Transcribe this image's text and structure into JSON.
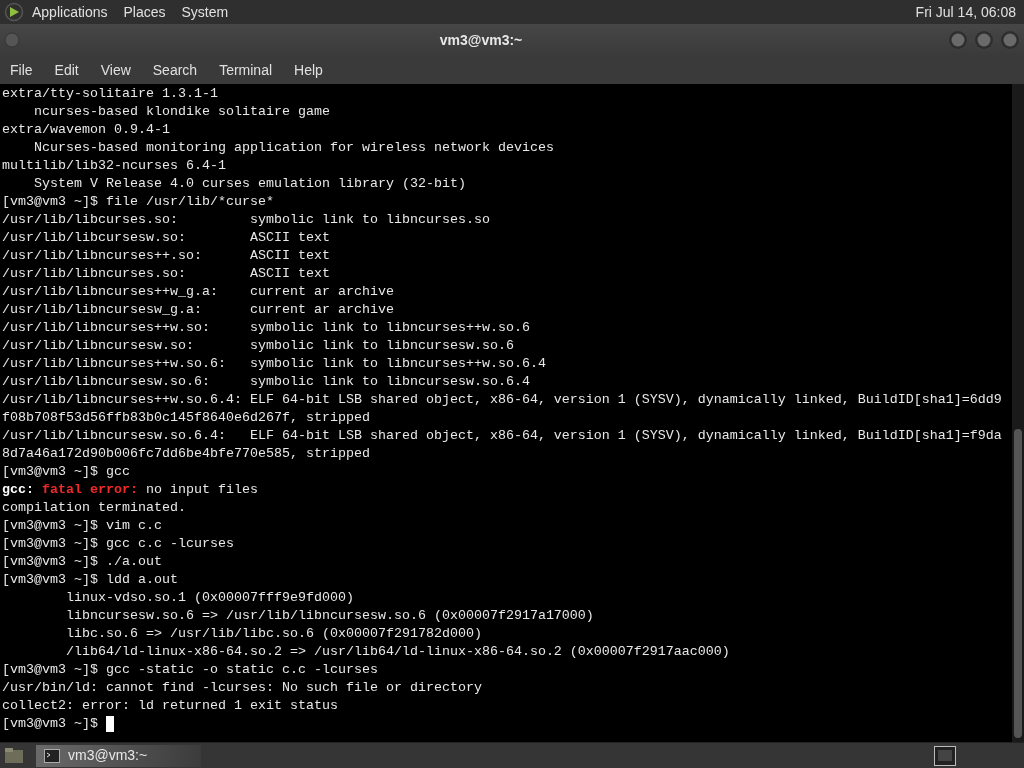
{
  "top_panel": {
    "menus": [
      "Applications",
      "Places",
      "System"
    ],
    "clock": "Fri Jul 14, 06:08"
  },
  "window": {
    "title": "vm3@vm3:~",
    "menu": [
      "File",
      "Edit",
      "View",
      "Search",
      "Terminal",
      "Help"
    ]
  },
  "terminal": {
    "lines": [
      {
        "text": "extra/tty-solitaire 1.3.1-1"
      },
      {
        "text": "    ncurses-based klondike solitaire game"
      },
      {
        "text": "extra/wavemon 0.9.4-1"
      },
      {
        "text": "    Ncurses-based monitoring application for wireless network devices"
      },
      {
        "text": "multilib/lib32-ncurses 6.4-1"
      },
      {
        "text": "    System V Release 4.0 curses emulation library (32-bit)"
      },
      {
        "text": "[vm3@vm3 ~]$ file /usr/lib/*curse*"
      },
      {
        "text": "/usr/lib/libcurses.so:         symbolic link to libncurses.so"
      },
      {
        "text": "/usr/lib/libcursesw.so:        ASCII text"
      },
      {
        "text": "/usr/lib/libncurses++.so:      ASCII text"
      },
      {
        "text": "/usr/lib/libncurses.so:        ASCII text"
      },
      {
        "text": "/usr/lib/libncurses++w_g.a:    current ar archive"
      },
      {
        "text": "/usr/lib/libncursesw_g.a:      current ar archive"
      },
      {
        "text": "/usr/lib/libncurses++w.so:     symbolic link to libncurses++w.so.6"
      },
      {
        "text": "/usr/lib/libncursesw.so:       symbolic link to libncursesw.so.6"
      },
      {
        "text": "/usr/lib/libncurses++w.so.6:   symbolic link to libncurses++w.so.6.4"
      },
      {
        "text": "/usr/lib/libncursesw.so.6:     symbolic link to libncursesw.so.6.4"
      },
      {
        "text": "/usr/lib/libncurses++w.so.6.4: ELF 64-bit LSB shared object, x86-64, version 1 (SYSV), dynamically linked, BuildID[sha1]=6dd9"
      },
      {
        "text": "f08b708f53d56ffb83b0c145f8640e6d267f, stripped"
      },
      {
        "text": "/usr/lib/libncursesw.so.6.4:   ELF 64-bit LSB shared object, x86-64, version 1 (SYSV), dynamically linked, BuildID[sha1]=f9da"
      },
      {
        "text": "8d7a46a172d90b006fc7dd6be4bfe770e585, stripped"
      },
      {
        "text": "[vm3@vm3 ~]$ gcc"
      },
      {
        "parts": [
          {
            "kind": "bold",
            "text": "gcc: "
          },
          {
            "kind": "error",
            "text": "fatal error: "
          },
          {
            "kind": "plain",
            "text": "no input files"
          }
        ]
      },
      {
        "text": "compilation terminated."
      },
      {
        "text": "[vm3@vm3 ~]$ vim c.c"
      },
      {
        "text": "[vm3@vm3 ~]$ gcc c.c -lcurses"
      },
      {
        "text": "[vm3@vm3 ~]$ ./a.out"
      },
      {
        "text": "[vm3@vm3 ~]$ ldd a.out"
      },
      {
        "text": "        linux-vdso.so.1 (0x00007fff9e9fd000)"
      },
      {
        "text": "        libncursesw.so.6 => /usr/lib/libncursesw.so.6 (0x00007f2917a17000)"
      },
      {
        "text": "        libc.so.6 => /usr/lib/libc.so.6 (0x00007f291782d000)"
      },
      {
        "text": "        /lib64/ld-linux-x86-64.so.2 => /usr/lib64/ld-linux-x86-64.so.2 (0x00007f2917aac000)"
      },
      {
        "text": "[vm3@vm3 ~]$ gcc -static -o static c.c -lcurses"
      },
      {
        "text": "/usr/bin/ld: cannot find -lcurses: No such file or directory"
      },
      {
        "text": "collect2: error: ld returned 1 exit status"
      },
      {
        "text": "[vm3@vm3 ~]$ ",
        "cursor": true
      }
    ]
  },
  "taskbar": {
    "tasks": [
      {
        "label": "vm3@vm3:~",
        "selected": true
      }
    ]
  }
}
